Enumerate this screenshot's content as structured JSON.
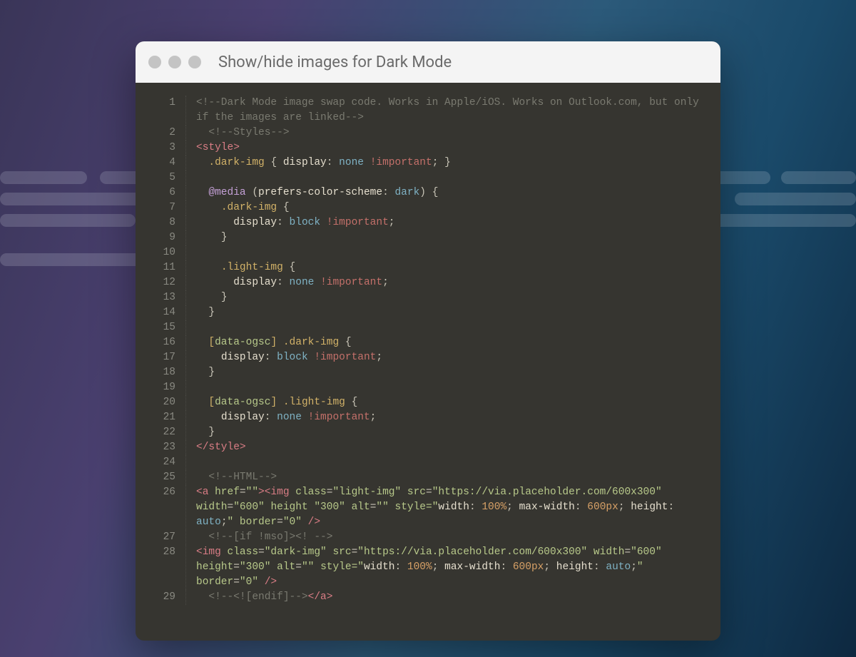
{
  "window": {
    "title": "Show/hide images for Dark Mode"
  },
  "colors": {
    "editorBg": "#363530",
    "titlebarBg": "#f4f4f4",
    "trafficDot": "#c4c4c4"
  },
  "code": {
    "lineNumbers": [
      "1",
      "2",
      "3",
      "4",
      "5",
      "6",
      "7",
      "8",
      "9",
      "10",
      "11",
      "12",
      "13",
      "14",
      "15",
      "16",
      "17",
      "18",
      "19",
      "20",
      "21",
      "22",
      "23",
      "24",
      "25",
      "26",
      "27",
      "28",
      "29"
    ],
    "wrapAfter": {
      "1": 1,
      "26": 2,
      "28": 2
    },
    "lines": {
      "l1": "<!--Dark Mode image swap code. Works in Apple/iOS. Works on Outlook.com, but only if the images are linked-->",
      "l2": "  <!--Styles-->",
      "l3_open": "<style>",
      "l4_sel": ".dark-img",
      "l4_decl": " { display: none !important; }",
      "l6_media": "@media",
      "l6_feat": "(prefers-color-scheme: dark)",
      "l6_brace": " {",
      "l7_sel": ".dark-img",
      "l7_brace": " {",
      "l8_decl": "display: block !important;",
      "l9_close": "}",
      "l11_sel": ".light-img",
      "l11_brace": " {",
      "l12_decl": "display: none !important;",
      "l13_close": "}",
      "l14_close": "}",
      "l16_sel": "[data-ogsc] .dark-img",
      "l16_brace": " {",
      "l17_decl": "display: block !important;",
      "l18_close": "}",
      "l20_sel": "[data-ogsc] .light-img",
      "l20_brace": " {",
      "l21_decl": "display: none !important;",
      "l22_close": "}",
      "l23_close": "</style>",
      "l25_cmt": "  <!--HTML-->",
      "l26": "<a href=\"\"><img class=\"light-img\" src=\"https://via.placeholder.com/600x300\" width=\"600\" height \"300\" alt=\"\" style=\"width: 100%; max-width: 600px; height: auto;\" border=\"0\" />",
      "l27_cmt": "  <!--[if !mso]><! -->",
      "l28": "<img class=\"dark-img\" src=\"https://via.placeholder.com/600x300\" width=\"600\" height=\"300\" alt=\"\" style=\"width: 100%; max-width: 600px; height: auto;\" border=\"0\" />",
      "l29_cmt": "  <!--<![endif]-->",
      "l29_close": "</a>"
    }
  }
}
